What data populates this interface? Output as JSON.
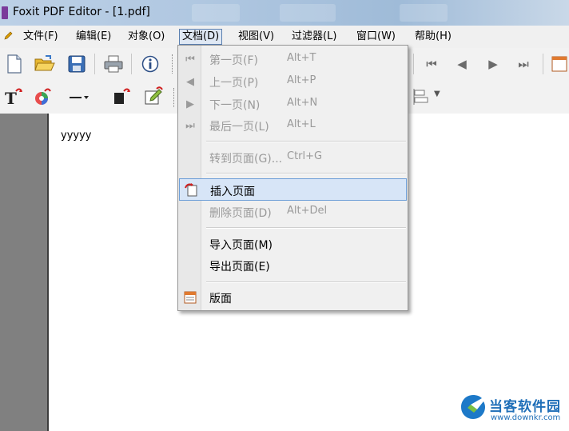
{
  "window": {
    "title": "Foxit PDF Editor - [1.pdf]"
  },
  "menubar": {
    "items": [
      {
        "label": "文件(F)"
      },
      {
        "label": "编辑(E)"
      },
      {
        "label": "对象(O)"
      },
      {
        "label": "文档(D)"
      },
      {
        "label": "视图(V)"
      },
      {
        "label": "过滤器(L)"
      },
      {
        "label": "窗口(W)"
      },
      {
        "label": "帮助(H)"
      }
    ],
    "active_index": 3
  },
  "document": {
    "text": "yyyyy"
  },
  "doc_menu": {
    "items": [
      {
        "label": "第一页(F)",
        "shortcut": "Alt+T",
        "icon": "first-page-icon",
        "enabled": false
      },
      {
        "label": "上一页(P)",
        "shortcut": "Alt+P",
        "icon": "prev-page-icon",
        "enabled": false
      },
      {
        "label": "下一页(N)",
        "shortcut": "Alt+N",
        "icon": "next-page-icon",
        "enabled": false
      },
      {
        "label": "最后一页(L)",
        "shortcut": "Alt+L",
        "icon": "last-page-icon",
        "enabled": false
      },
      {
        "label": "转到页面(G)...",
        "shortcut": "Ctrl+G",
        "icon": "",
        "enabled": false
      },
      {
        "label": "插入页面",
        "shortcut": "",
        "icon": "insert-page-icon",
        "enabled": true,
        "highlighted": true
      },
      {
        "label": "删除页面(D)",
        "shortcut": "Alt+Del",
        "icon": "",
        "enabled": false
      },
      {
        "label": "导入页面(M)",
        "shortcut": "",
        "icon": "",
        "enabled": true
      },
      {
        "label": "导出页面(E)",
        "shortcut": "",
        "icon": "",
        "enabled": true
      },
      {
        "label": "版面",
        "shortcut": "",
        "icon": "layout-icon",
        "enabled": true
      }
    ]
  },
  "watermark": {
    "title": "当客软件园",
    "url": "www.downkr.com"
  },
  "colors": {
    "highlight_bg": "#d7e5f7",
    "highlight_border": "#6e9fd8",
    "disabled_text": "#9a9a9a"
  }
}
